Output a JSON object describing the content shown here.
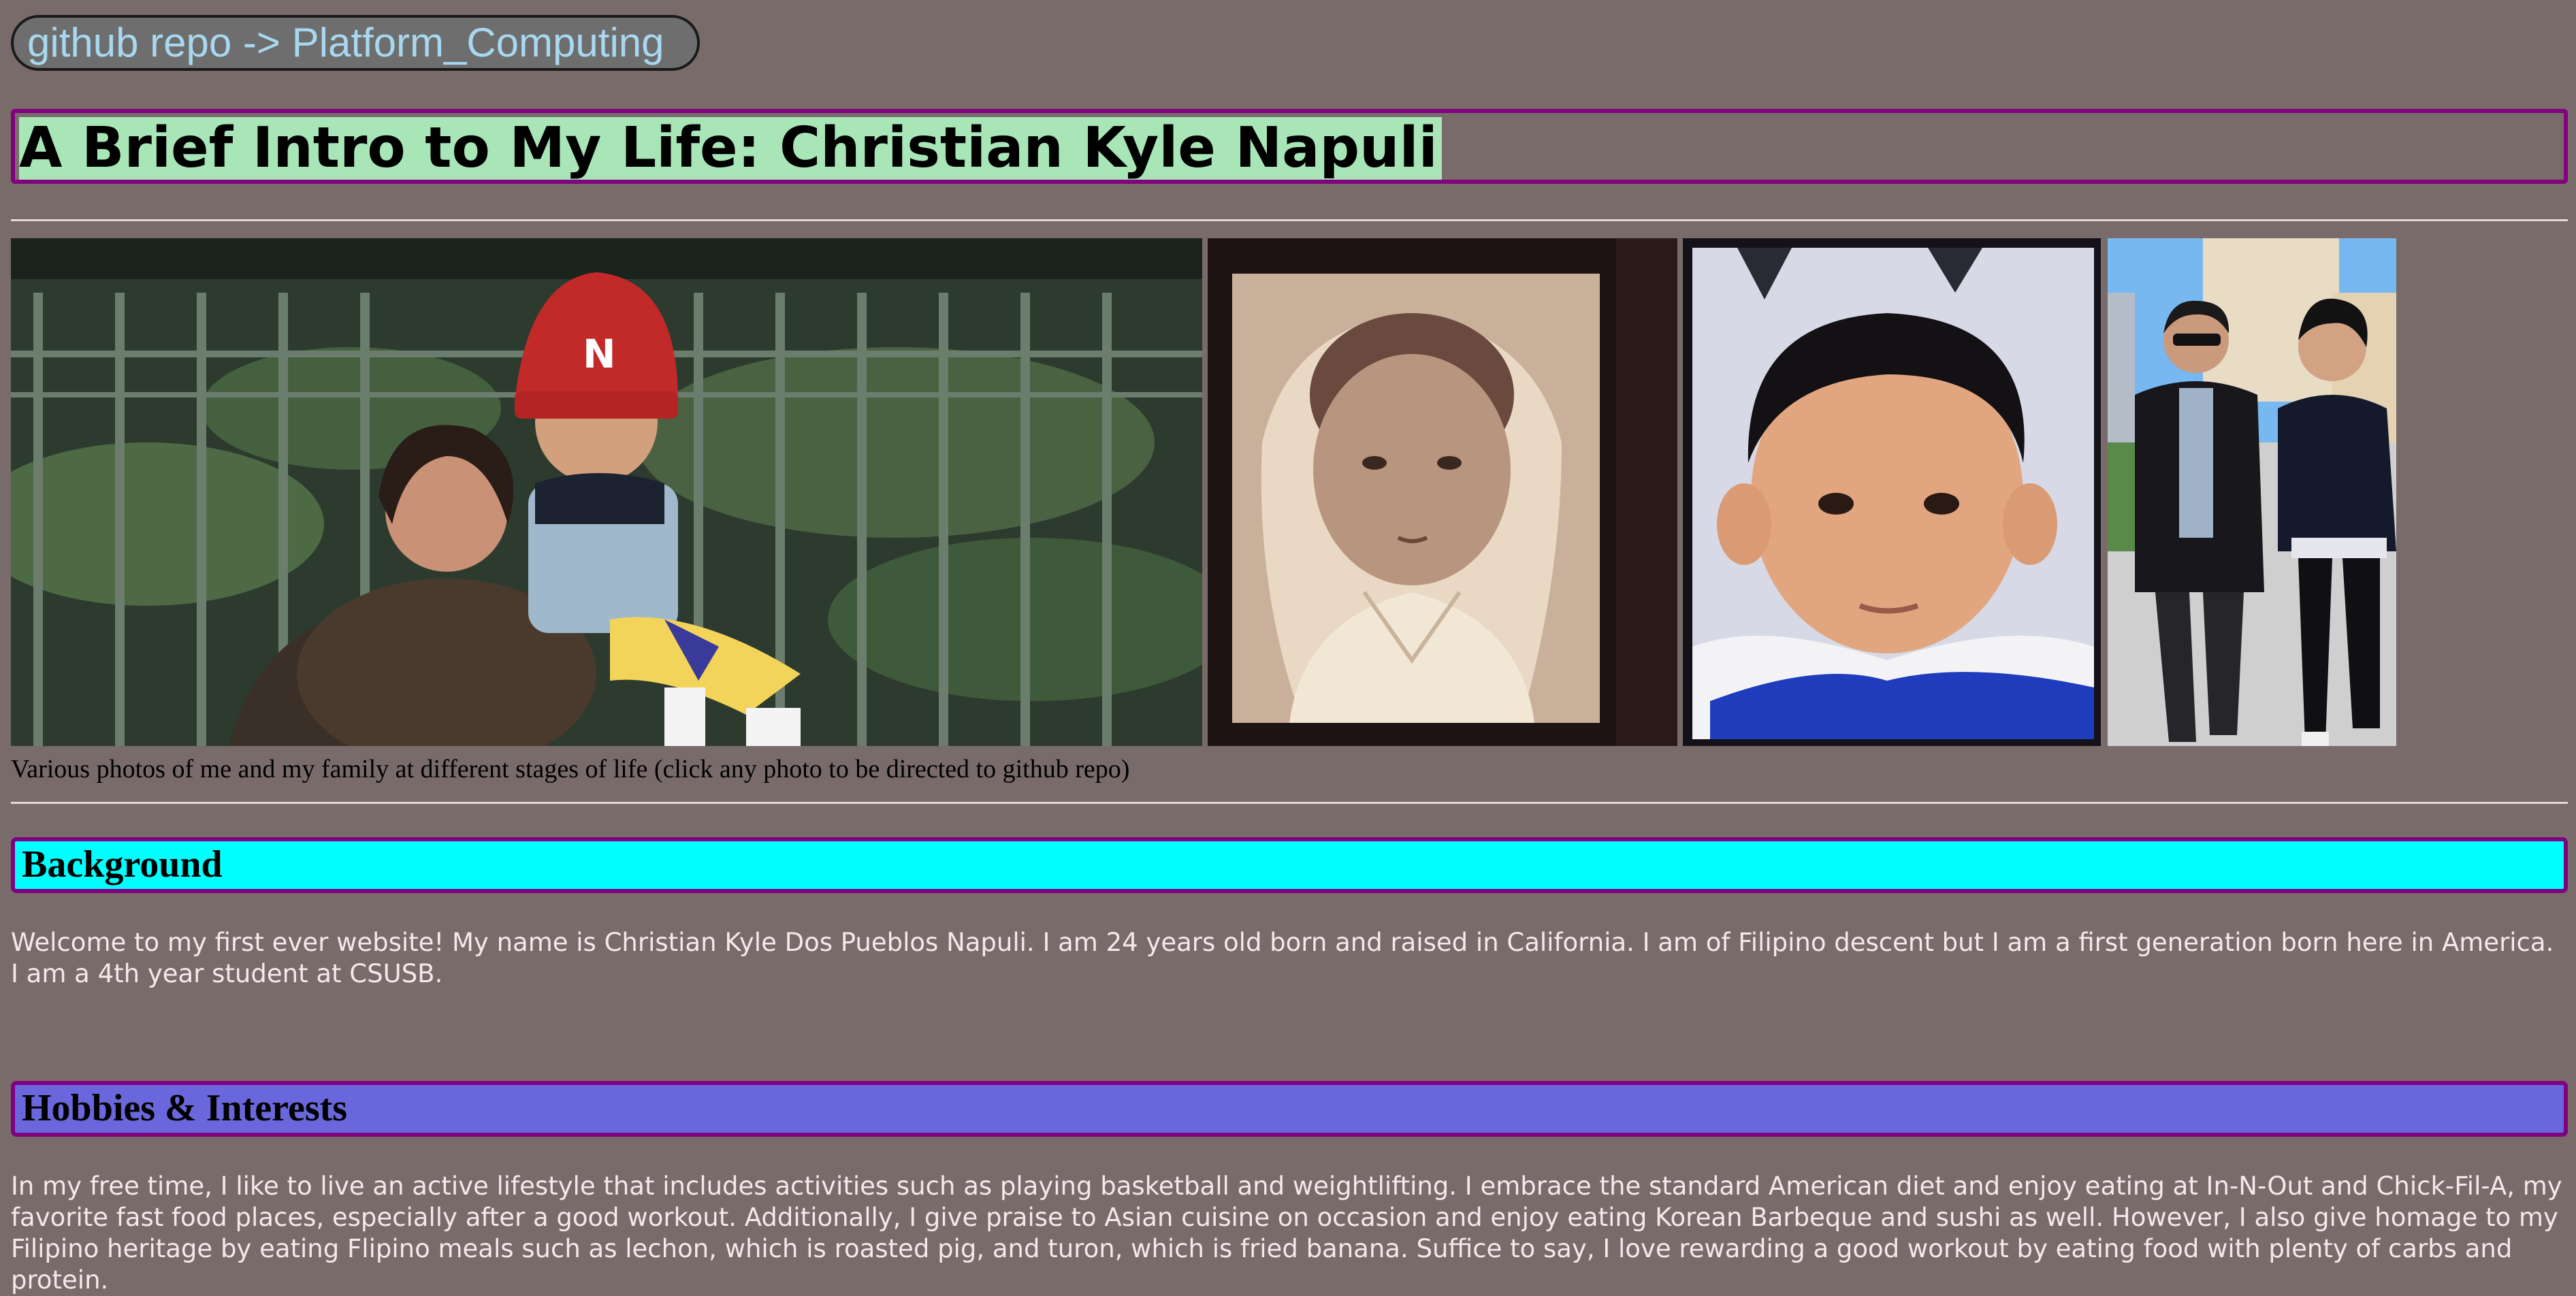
{
  "repo_link": {
    "label": "github repo -> Platform_Computing"
  },
  "page_title": "A Brief Intro to My Life: Christian Kyle Napuli",
  "gallery": {
    "caption": "Various photos of me and my family at different stages of life (click any photo to be directed to github repo)"
  },
  "sections": [
    {
      "heading": "Background",
      "heading_color": "#00ffff",
      "body": "Welcome to my first ever website! My name is Christian Kyle Dos Pueblos Napuli. I am 24 years old born and raised in California. I am of Filipino descent but I am a first generation born here in America. I am a 4th year student at CSUSB."
    },
    {
      "heading": "Hobbies & Interests",
      "heading_color": "#6a67dc",
      "body": "In my free time, I like to live an active lifestyle that includes activities such as playing basketball and weightlifting. I embrace the standard American diet and enjoy eating at In-N-Out and Chick-Fil-A, my favorite fast food places, especially after a good workout. Additionally, I give praise to Asian cuisine on occasion and enjoy eating Korean Barbeque and sushi as well. However, I also give homage to my Filipino heritage by eating Flipino meals such as lechon, which is roasted pig, and turon, which is fried banana. Suffice to say, I love rewarding a good workout by eating food with plenty of carbs and protein."
    }
  ],
  "colors": {
    "background": "#7a6b6b",
    "title_border": "#800080",
    "title_highlight": "#a8e6b8"
  }
}
